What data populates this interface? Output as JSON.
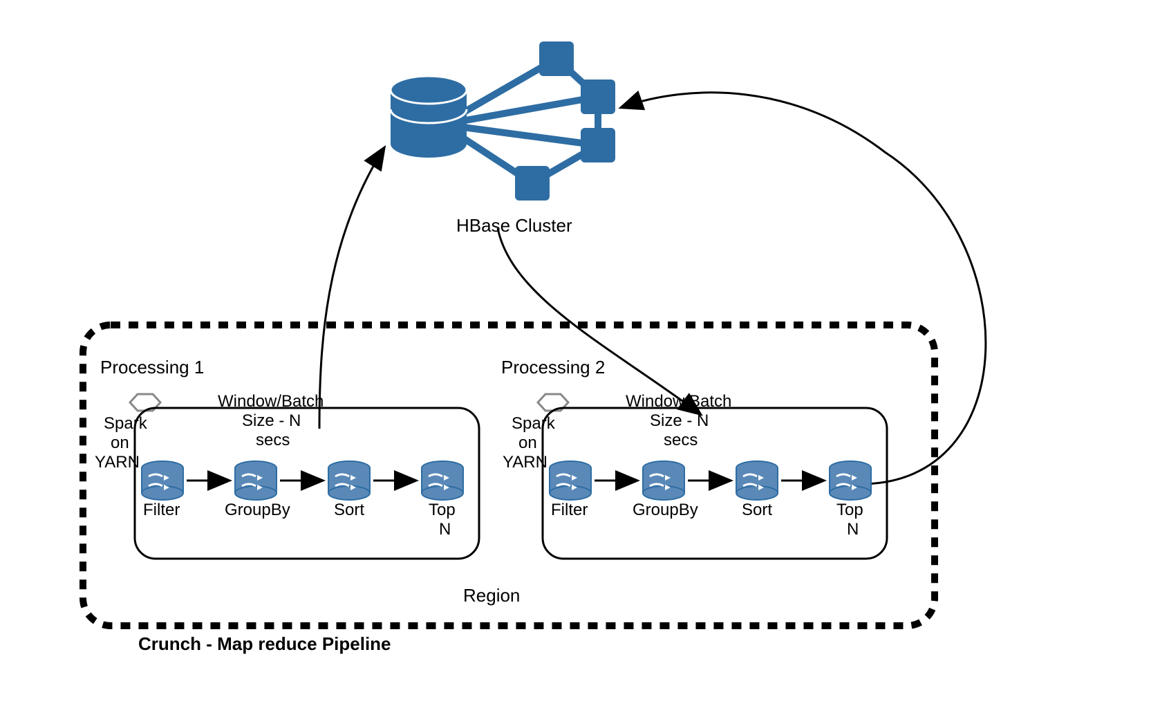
{
  "colors": {
    "blue": "#2e6da3",
    "blueLight": "#5a89b8",
    "black": "#000000"
  },
  "cluster": {
    "label": "HBase Cluster"
  },
  "pipeline": {
    "title": "Crunch - Map reduce Pipeline",
    "region_label": "Region"
  },
  "processing": {
    "1": {
      "title": "Processing 1",
      "engine": [
        "Spark",
        "on",
        "YARN"
      ],
      "window": [
        "Window/Batch",
        "Size - N",
        "secs"
      ],
      "stages": [
        "Filter",
        "GroupBy",
        "Sort",
        "Top",
        "N"
      ]
    },
    "2": {
      "title": "Processing 2",
      "engine": [
        "Spark",
        "on",
        "YARN"
      ],
      "window": [
        "Window/Batch",
        "Size - N",
        "secs"
      ],
      "stages": [
        "Filter",
        "GroupBy",
        "Sort",
        "Top",
        "N"
      ]
    }
  }
}
